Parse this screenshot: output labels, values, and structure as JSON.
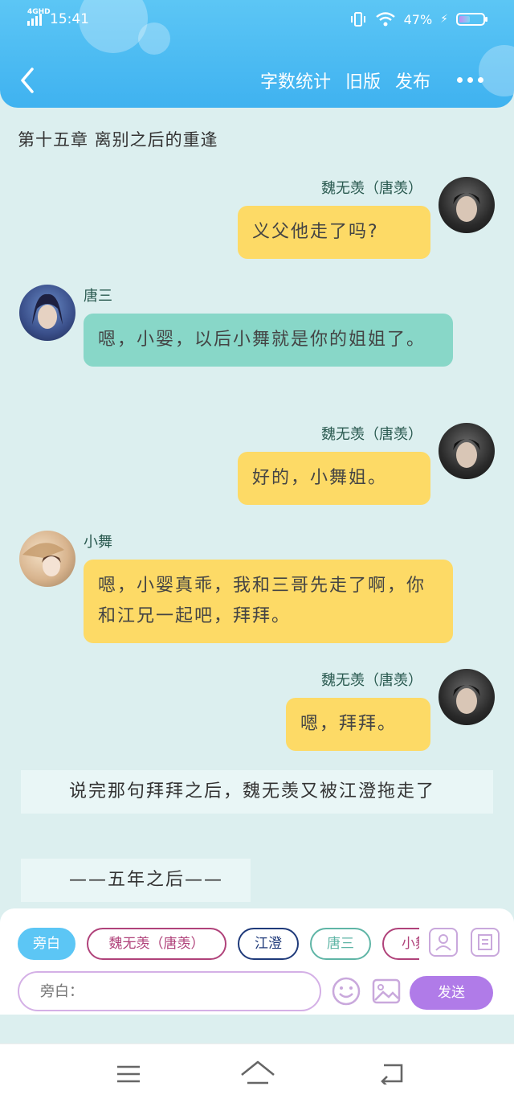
{
  "status": {
    "network": "4GHD",
    "time": "15:41",
    "battery_percent": "47%",
    "battery_level": 0.47
  },
  "nav": {
    "actions": [
      "字数统计",
      "旧版",
      "发布"
    ]
  },
  "chapter_title": "第十五章 离别之后的重逢",
  "messages": [
    {
      "side": "right",
      "name": "魏无羡（唐羡）",
      "text": "义父他走了吗?",
      "color": "yellow",
      "avatar": "avatar-wei"
    },
    {
      "side": "left",
      "name": "唐三",
      "text": "嗯，小婴，以后小舞就是你的姐姐了。",
      "color": "teal",
      "avatar": "avatar-tangsan"
    },
    {
      "side": "right",
      "name": "魏无羡（唐羡）",
      "text": "好的，小舞姐。",
      "color": "yellow",
      "avatar": "avatar-wei"
    },
    {
      "side": "left",
      "name": "小舞",
      "text": "嗯，小婴真乖，我和三哥先走了啊，你和江兄一起吧，拜拜。",
      "color": "yellow",
      "avatar": "avatar-xiaowu"
    },
    {
      "side": "right",
      "name": "魏无羡（唐羡）",
      "text": "嗯，拜拜。",
      "color": "yellow",
      "avatar": "avatar-wei"
    }
  ],
  "narrations": [
    "说完那句拜拜之后，魏无羡又被江澄拖走了",
    "——五年之后——"
  ],
  "roles": [
    "旁白",
    "魏无羡（唐羡）",
    "江澄",
    "唐三",
    "小舞"
  ],
  "input": {
    "placeholder": "旁白："
  },
  "send_label": "发送",
  "colors": {
    "header": "#3fb2f0",
    "yellow_bubble": "#fdda66",
    "teal_bubble": "#88d7c8",
    "send": "#b07be8",
    "role_active": "#5cc6f5"
  }
}
